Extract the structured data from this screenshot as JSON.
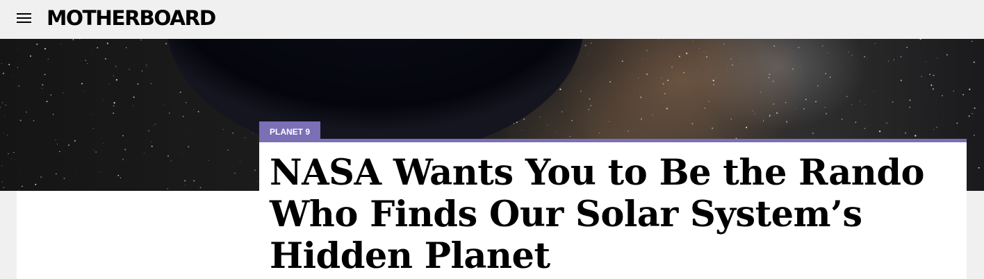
{
  "header": {
    "logo_text": "MOTHERBOARD",
    "menu_icon": "hamburger-menu-icon"
  },
  "hero": {
    "image_subject": "planet-and-milky-way"
  },
  "article": {
    "tag": "PLANET 9",
    "headline": "NASA Wants You to Be the Rando Who Finds Our Solar System’s Hidden Planet"
  },
  "colors": {
    "accent": "#7b6fb6",
    "page_bg": "#f0f0f0",
    "card_bg": "#ffffff"
  }
}
